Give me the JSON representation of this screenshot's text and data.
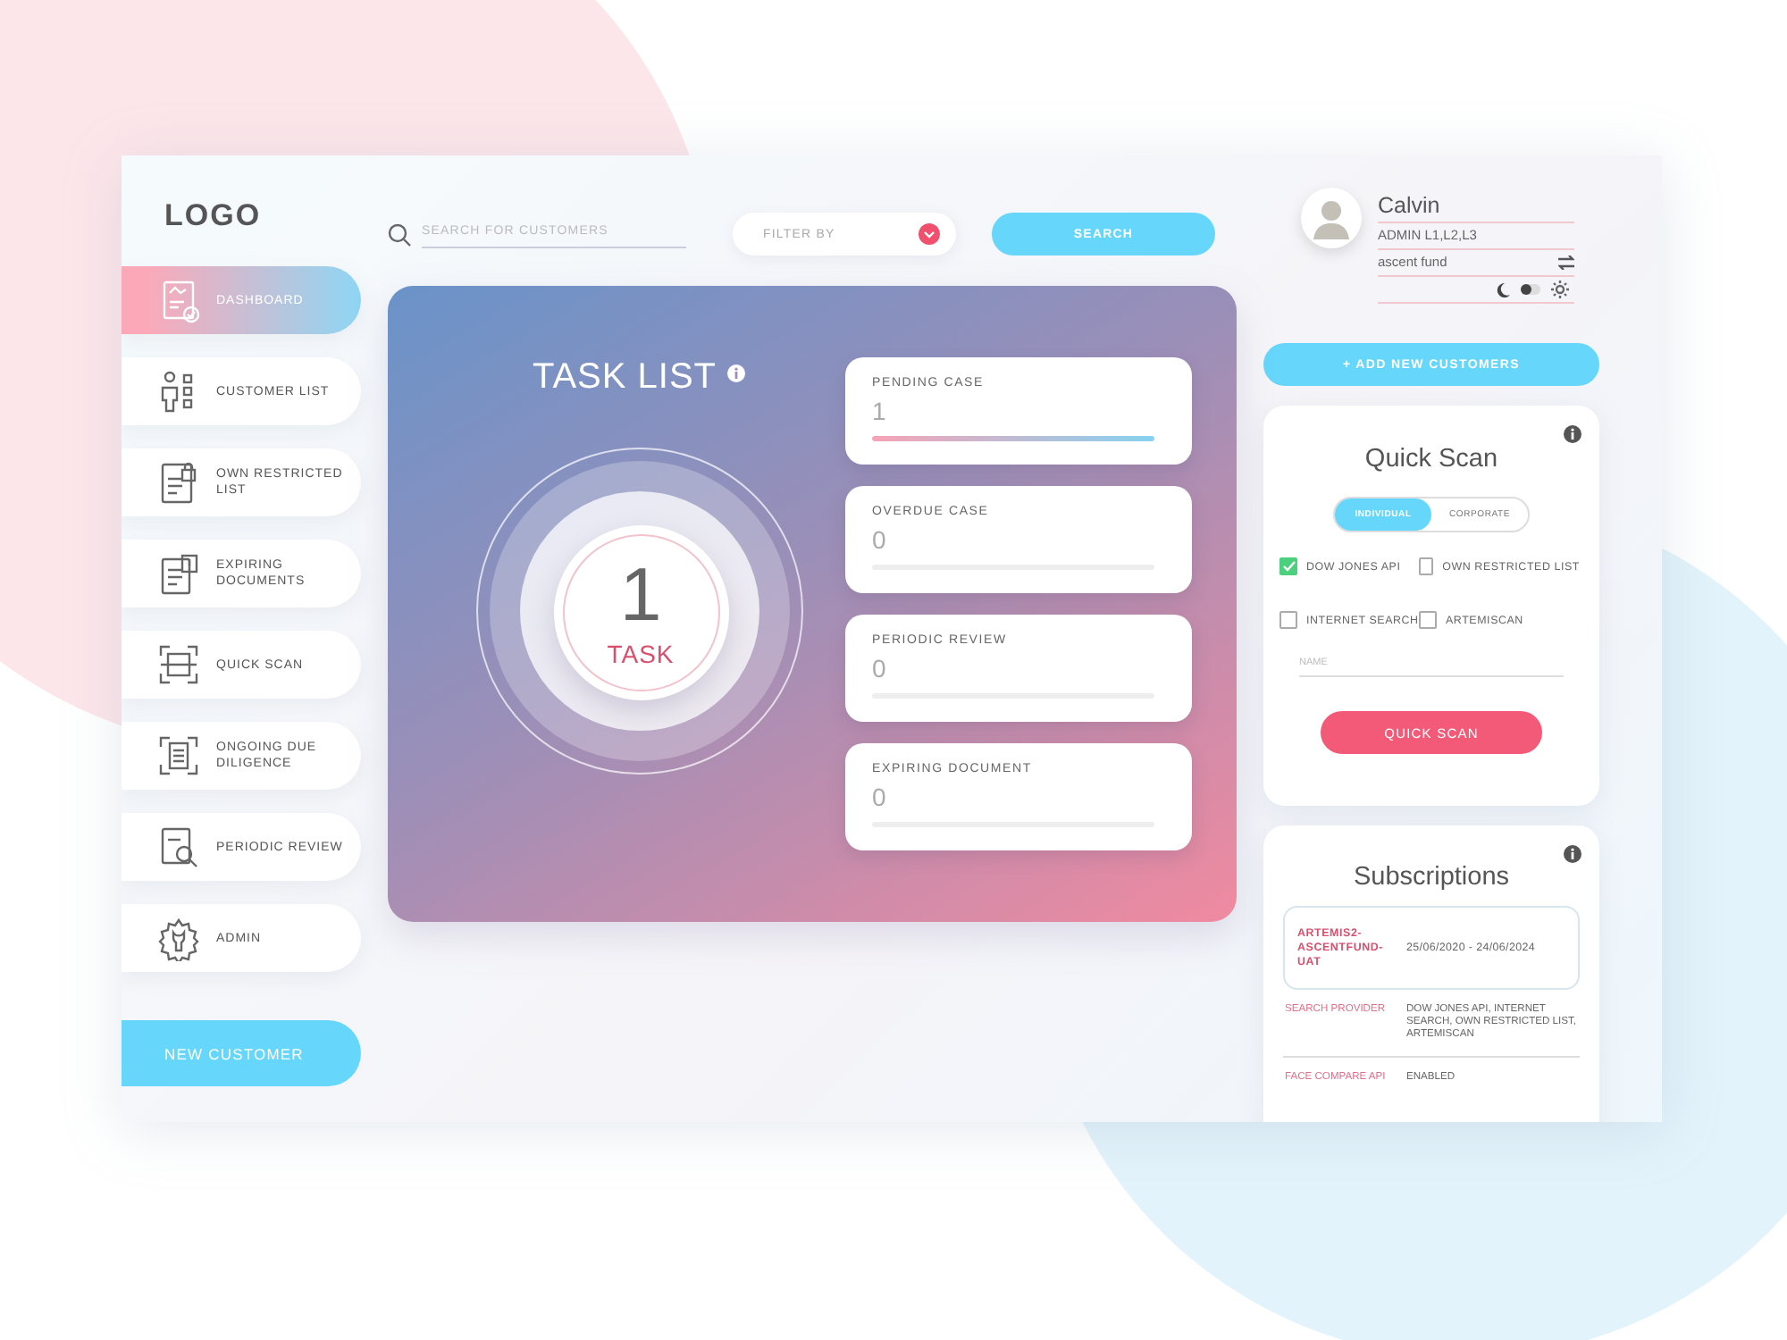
{
  "logo": "LOGO",
  "sidebar": {
    "items": [
      {
        "label": "DASHBOARD",
        "selected": true
      },
      {
        "label": "CUSTOMER LIST",
        "selected": false
      },
      {
        "label": "OWN RESTRICTED LIST",
        "selected": false
      },
      {
        "label": "EXPIRING DOCUMENTS",
        "selected": false
      },
      {
        "label": "QUICK SCAN",
        "selected": false
      },
      {
        "label": "ONGOING DUE DILIGENCE",
        "selected": false
      },
      {
        "label": "PERIODIC REVIEW",
        "selected": false
      },
      {
        "label": "ADMIN",
        "selected": false
      }
    ],
    "new_customer_button": "NEW CUSTOMER"
  },
  "toolbar": {
    "search": {
      "placeholder": "SEARCH FOR CUSTOMERS"
    },
    "filter": {
      "placeholder": "FILTER BY"
    },
    "search_button": "SEARCH"
  },
  "task_list": {
    "title": "TASK LIST",
    "count": "1",
    "count_label": "TASK",
    "cards": [
      {
        "label": "PENDING CASE",
        "value": "1",
        "level": 1
      },
      {
        "label": "OVERDUE CASE",
        "value": "0",
        "level": 0
      },
      {
        "label": "PERIODIC REVIEW",
        "value": "0",
        "level": 0
      },
      {
        "label": "EXPIRING DOCUMENT",
        "value": "0",
        "level": 0
      }
    ]
  },
  "profile": {
    "name": "Calvin",
    "role": "ADMIN L1,L2,L3",
    "fund": "ascent fund",
    "dark_mode": false
  },
  "add_customers_button": "+ ADD NEW CUSTOMERS",
  "quick_scan": {
    "title": "Quick Scan",
    "types": [
      {
        "label": "INDIVIDUAL",
        "selected": true
      },
      {
        "label": "CORPORATE",
        "selected": false
      }
    ],
    "sources": [
      {
        "label": "DOW JONES API",
        "checked": true
      },
      {
        "label": "OWN RESTRICTED LIST",
        "checked": false
      },
      {
        "label": "INTERNET SEARCH",
        "checked": false
      },
      {
        "label": "ARTEMISCAN",
        "checked": false
      }
    ],
    "name_field": {
      "placeholder": "NAME"
    },
    "button": "QUICK SCAN"
  },
  "subscriptions": {
    "title": "Subscriptions",
    "plan": {
      "name": "ARTEMIS2-ASCENTFUND-UAT",
      "period": "25/06/2020 - 24/06/2024"
    },
    "rows": [
      {
        "label": "SEARCH PROVIDER",
        "value": "DOW JONES API, INTERNET SEARCH, OWN RESTRICTED LIST, ARTEMISCAN"
      },
      {
        "label": "FACE COMPARE API",
        "value": "ENABLED"
      }
    ]
  }
}
